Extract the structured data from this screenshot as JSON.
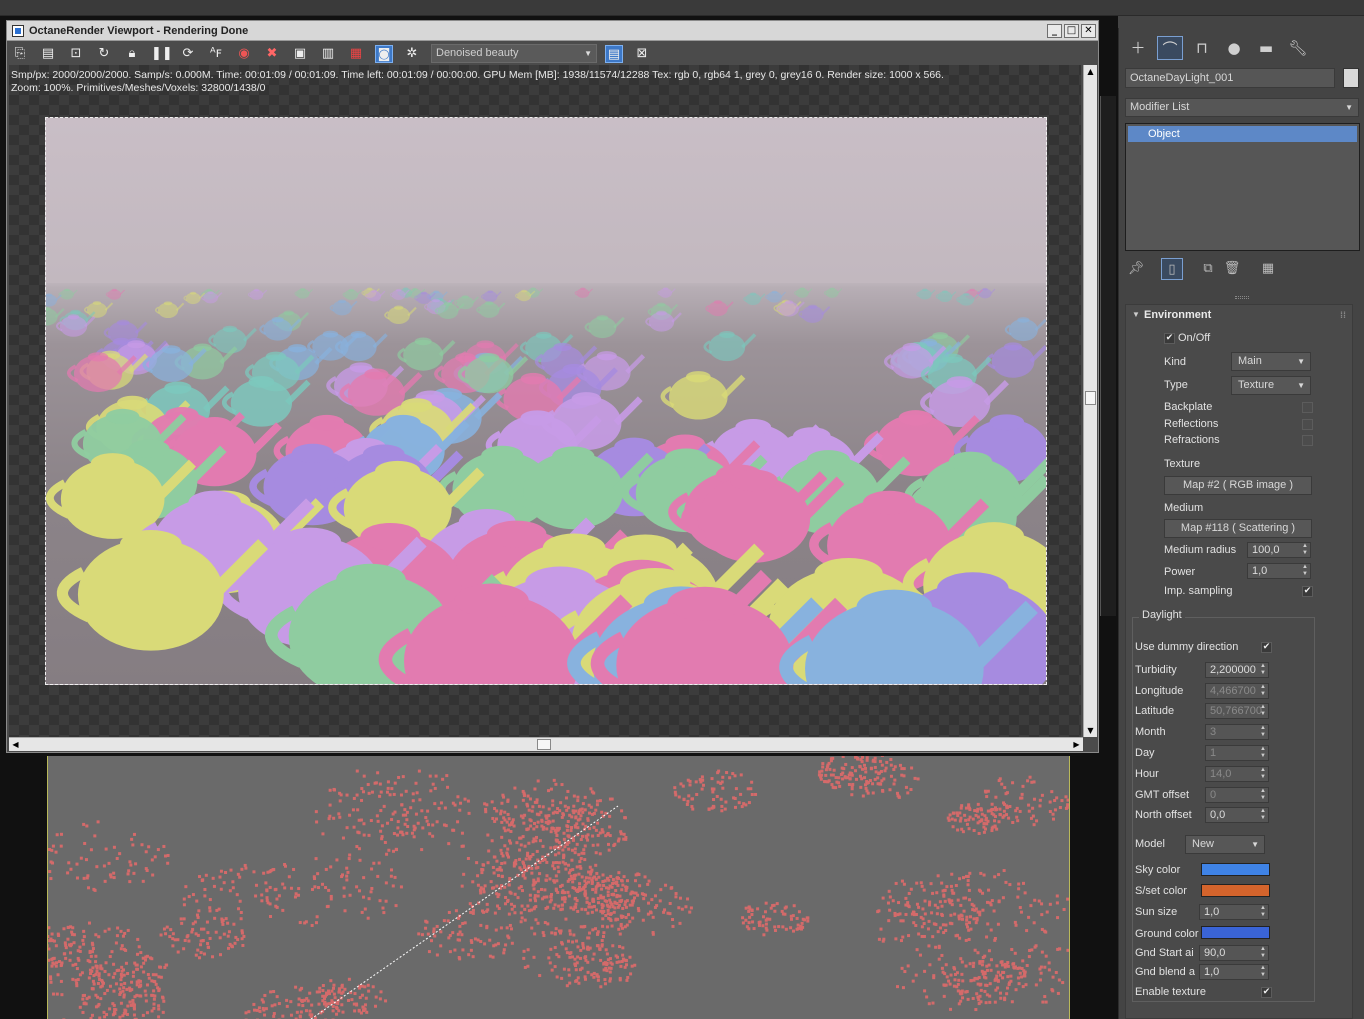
{
  "octane_window": {
    "title": "OctaneRender Viewport - Rendering Done",
    "render_pass": "Denoised beauty",
    "status_line1": "Smp/px: 2000/2000/2000.   Samp/s: 0.000M.   Time: 00:01:09 / 00:01:09.   Time left: 00:01:09 / 00:00:00.   GPU Mem [MB]: 1938/11574/12288   Tex: rgb 0, rgb64 1, grey 0, grey16 0.   Render size: 1000 x 566.",
    "status_line2": "Zoom: 100%.   Primitives/Meshes/Voxels: 32800/1438/0",
    "window_buttons": {
      "minimize": "_",
      "maximize": "□",
      "close": "✕"
    },
    "toolbar_icons": [
      "save-image-icon",
      "export-passes-icon",
      "zoom-region-icon",
      "refresh-icon",
      "lock-icon",
      "pause-icon",
      "restart-icon",
      "af-icon",
      "color-wheel-icon",
      "stop-icon",
      "region-render-icon",
      "film-settings-icon",
      "red-settings-icon",
      "camera-pick-icon",
      "sun-icon",
      "panel-toggle-icon",
      "fit-window-icon"
    ]
  },
  "command_panel": {
    "tabs": [
      "create",
      "modify",
      "hierarchy",
      "motion",
      "display",
      "utilities"
    ],
    "object_name": "OctaneDayLight_001",
    "modifier_list": "Modifier List",
    "stack_items": [
      "Object"
    ],
    "rollout_title": "Environment",
    "env": {
      "on_off": "On/Off",
      "kind_label": "Kind",
      "kind_value": "Main",
      "type_label": "Type",
      "type_value": "Texture",
      "backplate": "Backplate",
      "reflections": "Reflections",
      "refractions": "Refractions",
      "texture_label": "Texture",
      "texture_map": "Map #2  ( RGB image )",
      "medium_label": "Medium",
      "medium_map": "Map #118  ( Scattering )",
      "medium_radius_label": "Medium radius",
      "medium_radius_value": "100,0",
      "power_label": "Power",
      "power_value": "1,0",
      "imp_sampling": "Imp. sampling"
    },
    "daylight": {
      "group_label": "Daylight",
      "use_dummy": "Use dummy direction",
      "turbidity_label": "Turbidity",
      "turbidity_value": "2,200000",
      "longitude_label": "Longitude",
      "longitude_value": "4,466700",
      "latitude_label": "Latitude",
      "latitude_value": "50,766700",
      "month_label": "Month",
      "month_value": "3",
      "day_label": "Day",
      "day_value": "1",
      "hour_label": "Hour",
      "hour_value": "14,0",
      "gmt_label": "GMT offset",
      "gmt_value": "0",
      "north_label": "North offset",
      "north_value": "0,0",
      "model_label": "Model",
      "model_value": "New",
      "sky_color_label": "Sky color",
      "sky_color": "#3f83e6",
      "sset_color_label": "S/set color",
      "sset_color": "#d4642c",
      "sun_size_label": "Sun size",
      "sun_size_value": "1,0",
      "ground_color_label": "Ground color",
      "ground_color": "#3a64d6",
      "gnd_start_label": "Gnd Start ai",
      "gnd_start_value": "90,0",
      "gnd_blend_label": "Gnd blend a",
      "gnd_blend_value": "1,0",
      "enable_texture": "Enable texture"
    }
  },
  "colors": {
    "accent": "#5d88c7",
    "particle": "#d46a6a"
  }
}
